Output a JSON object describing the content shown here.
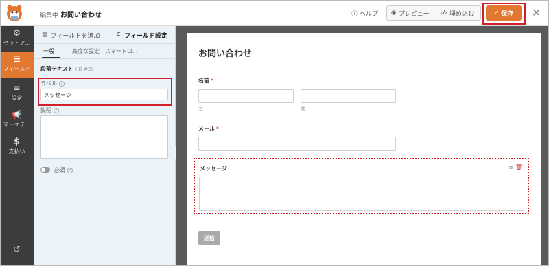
{
  "header": {
    "editing_label": "編集中",
    "form_name": "お問い合わせ",
    "help_label": "ヘルプ",
    "preview_label": "プレビュー",
    "embed_label": "埋め込む",
    "save_label": "保存",
    "accent_color": "#e27730"
  },
  "sidebar": {
    "items": [
      {
        "label": "セットア...",
        "icon": "gear-icon"
      },
      {
        "label": "フィールド",
        "icon": "fields-icon"
      },
      {
        "label": "設定",
        "icon": "sliders-icon"
      },
      {
        "label": "マーケテ...",
        "icon": "megaphone-icon"
      },
      {
        "label": "支払い",
        "icon": "dollar-icon"
      }
    ],
    "active_index": 1,
    "history_icon": "history-icon"
  },
  "panel": {
    "tabs": [
      "フィールドを追加",
      "フィールド設定"
    ],
    "subtabs": [
      "一般",
      "高度な設定",
      "スマートロ..."
    ],
    "field_title": "段落テキスト",
    "field_id": "(ID #2)",
    "label_label": "ラベル",
    "label_value": "メッセージ",
    "description_label": "説明",
    "required_label": "必須"
  },
  "form": {
    "title": "お問い合わせ",
    "name_label": "名前",
    "first_sub": "名",
    "last_sub": "姓",
    "email_label": "メール",
    "message_label": "メッセージ",
    "submit_label": "送信",
    "required_marker": "*"
  }
}
